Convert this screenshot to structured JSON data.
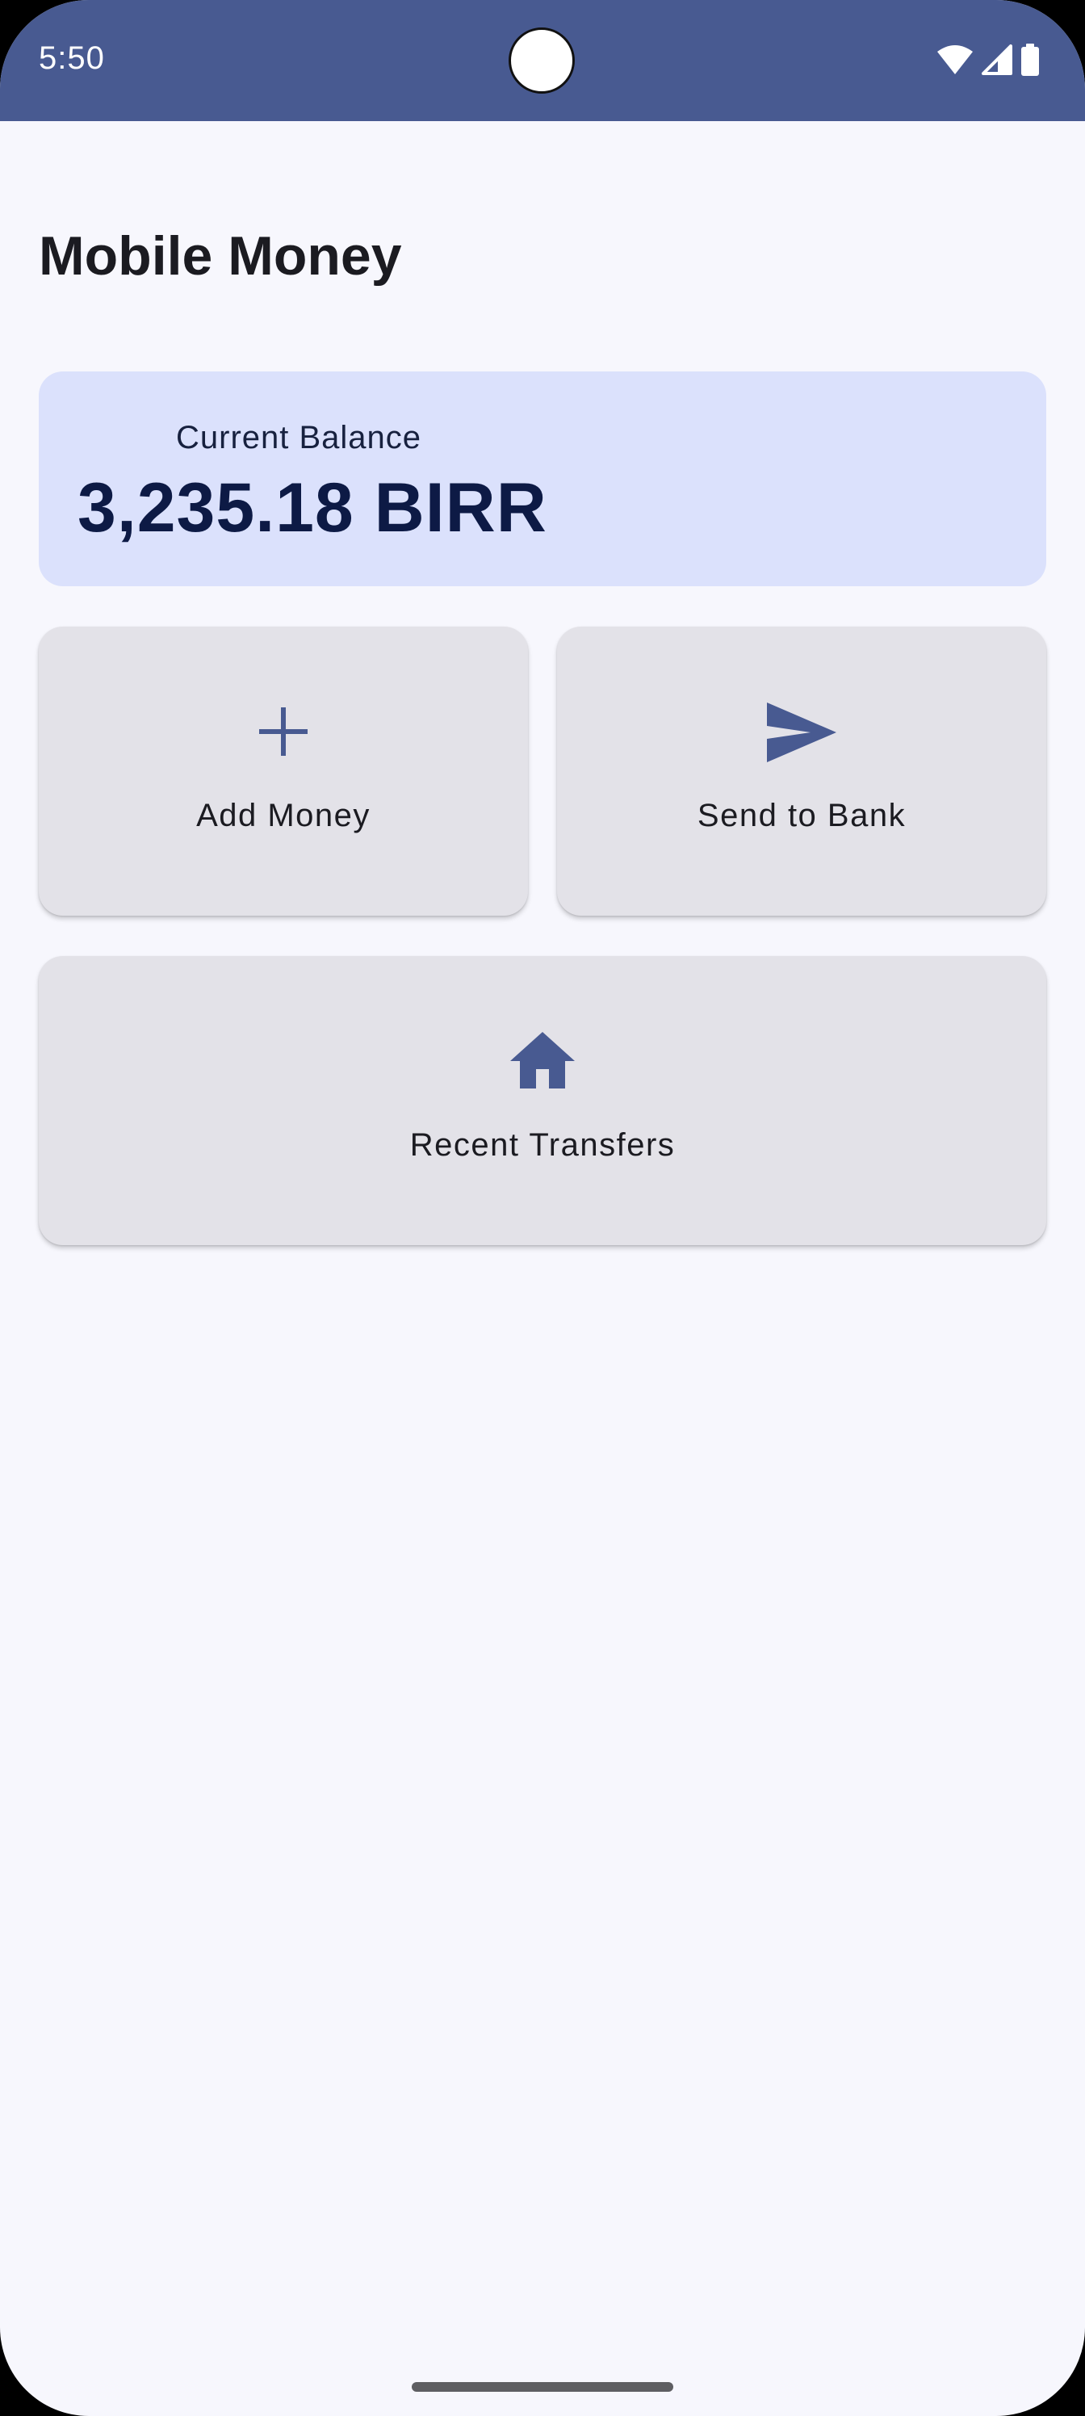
{
  "status_bar": {
    "time": "5:50",
    "icons": [
      "wifi-icon",
      "cellular-signal-icon",
      "battery-icon"
    ]
  },
  "app": {
    "title": "Mobile Money"
  },
  "balance": {
    "label": "Current Balance",
    "value": "3,235.18 BIRR"
  },
  "actions": [
    {
      "label": "Add Money",
      "icon": "plus-icon"
    },
    {
      "label": "Send to Bank",
      "icon": "send-icon"
    },
    {
      "label": "Recent Transfers",
      "icon": "home-icon"
    }
  ],
  "colors": {
    "status_bar": "#485a91",
    "accent": "#485a91",
    "background": "#f7f7fd",
    "balance_card": "#dbe1fc",
    "action_card": "#e3e2e8"
  }
}
